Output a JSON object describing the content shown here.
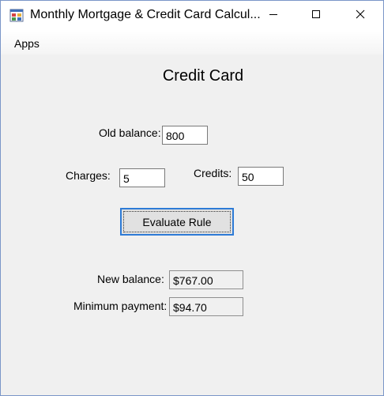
{
  "window": {
    "title": "Monthly Mortgage & Credit Card Calcul...",
    "icons": {
      "app": "app-icon",
      "minimize": "minimize-icon",
      "maximize": "maximize-icon",
      "close": "close-icon"
    }
  },
  "menu": {
    "items": [
      {
        "label": "Apps"
      }
    ]
  },
  "form": {
    "heading": "Credit Card",
    "old_balance": {
      "label": "Old balance:",
      "value": "800"
    },
    "charges": {
      "label": "Charges:",
      "value": "5"
    },
    "credits": {
      "label": "Credits:",
      "value": "50"
    },
    "evaluate_button": "Evaluate Rule",
    "new_balance": {
      "label": "New balance:",
      "value": "$767.00"
    },
    "minimum_payment": {
      "label": "Minimum payment:",
      "value": "$94.70"
    }
  },
  "colors": {
    "window_background": "#f0f0f0",
    "window_border": "#7a96c8",
    "button_focus_border": "#2e7bd6"
  }
}
